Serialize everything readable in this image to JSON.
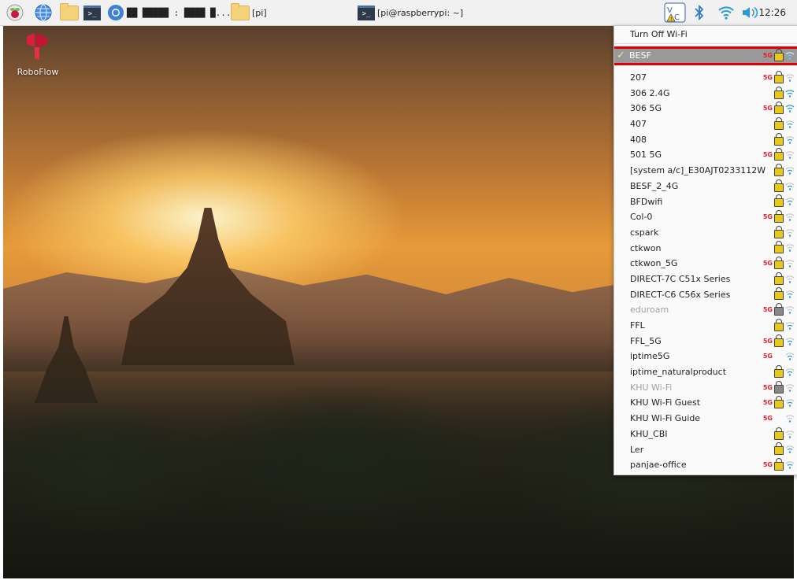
{
  "taskbar": {
    "raspberry_menu": "raspberry-pi-menu",
    "window_label_title": "██ █████ : ████ █...",
    "folder_pi_label": "[pi]",
    "terminal_window_label": "[pi@raspberrypi: ~]",
    "clock": "12:26"
  },
  "desktop": {
    "icon_label": "RoboFlow"
  },
  "wifi_menu": {
    "turn_off_label": "Turn Off Wi-Fi",
    "connected": {
      "ssid": "BESF",
      "band": "5G",
      "secured": true
    },
    "networks": [
      {
        "ssid": "207",
        "band": "5G",
        "secured": true,
        "signal": "weak",
        "dim": false
      },
      {
        "ssid": "306 2.4G",
        "band": "",
        "secured": true,
        "signal": "strong",
        "dim": false
      },
      {
        "ssid": "306 5G",
        "band": "5G",
        "secured": true,
        "signal": "strong",
        "dim": false
      },
      {
        "ssid": "407",
        "band": "",
        "secured": true,
        "signal": "medium",
        "dim": false
      },
      {
        "ssid": "408",
        "band": "",
        "secured": true,
        "signal": "medium",
        "dim": false
      },
      {
        "ssid": "501 5G",
        "band": "5G",
        "secured": true,
        "signal": "weak",
        "dim": false
      },
      {
        "ssid": "[system a/c]_E30AJT0233112W",
        "band": "",
        "secured": true,
        "signal": "medium",
        "dim": false
      },
      {
        "ssid": "BESF_2_4G",
        "band": "",
        "secured": true,
        "signal": "medium",
        "dim": false
      },
      {
        "ssid": "BFDwifi",
        "band": "",
        "secured": true,
        "signal": "medium",
        "dim": false
      },
      {
        "ssid": "Col-0",
        "band": "5G",
        "secured": true,
        "signal": "weak",
        "dim": false
      },
      {
        "ssid": "cspark",
        "band": "",
        "secured": true,
        "signal": "weak",
        "dim": false
      },
      {
        "ssid": "ctkwon",
        "band": "",
        "secured": true,
        "signal": "weak",
        "dim": false
      },
      {
        "ssid": "ctkwon_5G",
        "band": "5G",
        "secured": true,
        "signal": "weak",
        "dim": false
      },
      {
        "ssid": "DIRECT-7C C51x Series",
        "band": "",
        "secured": true,
        "signal": "weak",
        "dim": false
      },
      {
        "ssid": "DIRECT-C6 C56x Series",
        "band": "",
        "secured": true,
        "signal": "medium",
        "dim": false
      },
      {
        "ssid": "eduroam",
        "band": "5G",
        "secured": "enterprise",
        "signal": "weak",
        "dim": true
      },
      {
        "ssid": "FFL",
        "band": "",
        "secured": true,
        "signal": "medium",
        "dim": false
      },
      {
        "ssid": "FFL_5G",
        "band": "5G",
        "secured": true,
        "signal": "medium",
        "dim": false
      },
      {
        "ssid": "iptime5G",
        "band": "5G",
        "secured": false,
        "signal": "medium",
        "dim": false
      },
      {
        "ssid": "iptime_naturalproduct",
        "band": "",
        "secured": true,
        "signal": "medium",
        "dim": false
      },
      {
        "ssid": "KHU Wi-Fi",
        "band": "5G",
        "secured": "enterprise",
        "signal": "weak",
        "dim": true
      },
      {
        "ssid": "KHU Wi-Fi Guest",
        "band": "5G",
        "secured": true,
        "signal": "medium",
        "dim": false
      },
      {
        "ssid": "KHU Wi-Fi Guide",
        "band": "5G",
        "secured": false,
        "signal": "weak",
        "dim": false
      },
      {
        "ssid": "KHU_CBI",
        "band": "",
        "secured": true,
        "signal": "weak",
        "dim": false
      },
      {
        "ssid": "Ler",
        "band": "",
        "secured": true,
        "signal": "medium",
        "dim": false
      },
      {
        "ssid": "panjae-office",
        "band": "5G",
        "secured": true,
        "signal": "medium",
        "dim": false
      }
    ]
  },
  "colors": {
    "taskbar_bg": "#f1f1f1",
    "highlight_border": "#e00000",
    "band_5g": "#e0202a",
    "wifi_blue": "#2a9bd8",
    "selected_bg": "#999999"
  }
}
